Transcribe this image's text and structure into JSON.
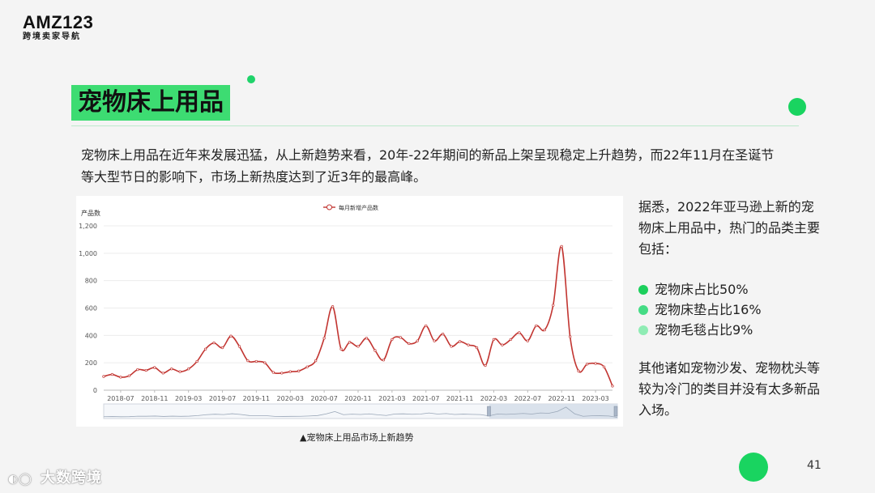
{
  "logo": {
    "main": "AMZ123",
    "sub": "跨境卖家导航"
  },
  "title": "宠物床上用品",
  "intro": "宠物床上用品在近年来发展迅猛，从上新趋势来看，20年-22年期间的新品上架呈现稳定上升趋势，而22年11月在圣诞节等大型节日的影响下，市场上新热度达到了近3年的最高峰。",
  "side": {
    "lead": "据悉，2022年亚马逊上新的宠物床上用品中，热门的品类主要包括：",
    "bullets": [
      {
        "label": "宠物床占比50%",
        "color": "#1ccf5c"
      },
      {
        "label": "宠物床垫占比16%",
        "color": "#45dc85"
      },
      {
        "label": "宠物毛毯占比9%",
        "color": "#8fecb4"
      }
    ],
    "other": "其他诸如宠物沙发、宠物枕头等较为冷门的类目并没有太多新品入场。"
  },
  "caption": "▲宠物床上用品市场上新趋势",
  "page_number": "41",
  "watermark": "大数跨境",
  "colors": {
    "accent": "#19d460",
    "title_bg": "#3ddc72",
    "series": "#c23531"
  },
  "chart_data": {
    "type": "line",
    "ylabel": "产品数",
    "legend": "每月新增产品数",
    "legend_position": "top-center",
    "ylim": [
      0,
      1200
    ],
    "yticks": [
      "0",
      "200",
      "400",
      "600",
      "800",
      "1,000",
      "1,200"
    ],
    "ytick_values": [
      0,
      200,
      400,
      600,
      800,
      1000,
      1200
    ],
    "xtick_labels": [
      "2018-07",
      "2018-11",
      "2019-03",
      "2019-07",
      "2019-11",
      "2020-03",
      "2020-07",
      "2020-11",
      "2021-03",
      "2021-07",
      "2021-11",
      "2022-03",
      "2022-07",
      "2022-11",
      "2023-03"
    ],
    "grid": true,
    "data_zoom": true,
    "series": [
      {
        "name": "每月新增产品数",
        "x": [
          "2018-05",
          "2018-06",
          "2018-07",
          "2018-08",
          "2018-09",
          "2018-10",
          "2018-11",
          "2018-12",
          "2019-01",
          "2019-02",
          "2019-03",
          "2019-04",
          "2019-05",
          "2019-06",
          "2019-07",
          "2019-08",
          "2019-09",
          "2019-10",
          "2019-11",
          "2019-12",
          "2020-01",
          "2020-02",
          "2020-03",
          "2020-04",
          "2020-05",
          "2020-06",
          "2020-07",
          "2020-08",
          "2020-09",
          "2020-10",
          "2020-11",
          "2020-12",
          "2021-01",
          "2021-02",
          "2021-03",
          "2021-04",
          "2021-05",
          "2021-06",
          "2021-07",
          "2021-08",
          "2021-09",
          "2021-10",
          "2021-11",
          "2021-12",
          "2022-01",
          "2022-02",
          "2022-03",
          "2022-04",
          "2022-05",
          "2022-06",
          "2022-07",
          "2022-08",
          "2022-09",
          "2022-10",
          "2022-11",
          "2022-12",
          "2023-01",
          "2023-02",
          "2023-03",
          "2023-04",
          "2023-05"
        ],
        "values": [
          100,
          115,
          95,
          105,
          150,
          145,
          165,
          125,
          155,
          135,
          155,
          210,
          300,
          345,
          310,
          395,
          320,
          215,
          210,
          200,
          130,
          125,
          135,
          140,
          170,
          215,
          380,
          610,
          300,
          350,
          320,
          380,
          290,
          220,
          370,
          385,
          340,
          360,
          470,
          360,
          410,
          320,
          355,
          330,
          310,
          180,
          370,
          330,
          370,
          420,
          360,
          470,
          440,
          620,
          1050,
          390,
          140,
          190,
          195,
          170,
          30
        ]
      }
    ]
  }
}
